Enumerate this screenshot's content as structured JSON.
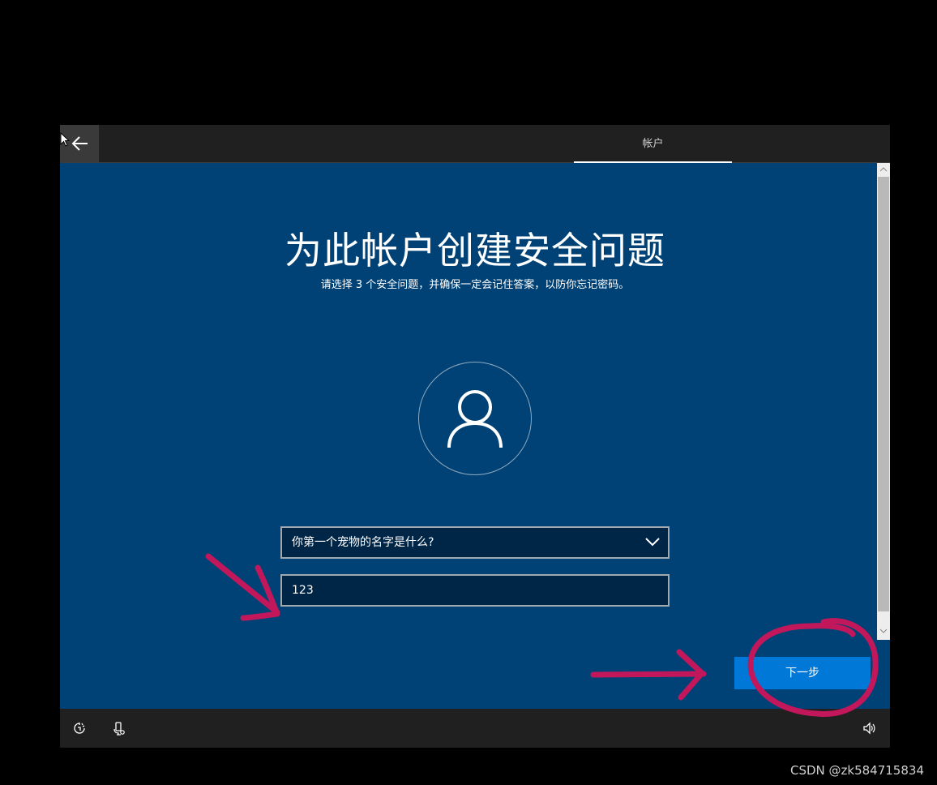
{
  "topbar": {
    "tab_label": "帐户"
  },
  "main": {
    "title": "为此帐户创建安全问题",
    "subtitle": "请选择 3 个安全问题，并确保一定会记住答案，以防你忘记密码。",
    "question_select": {
      "selected": "你第一个宠物的名字是什么?"
    },
    "answer_field": {
      "value": "123"
    },
    "next_button_label": "下一步"
  },
  "watermark": "CSDN @zk584715834",
  "colors": {
    "background": "#004275",
    "accent_button": "#0078d7",
    "annotation": "#c2185b"
  },
  "icons": {
    "back": "back-arrow-icon",
    "avatar": "user-avatar-icon",
    "dropdown": "chevron-down-icon",
    "ease_of_access": "ease-of-access-icon",
    "microphone": "microphone-icon",
    "volume": "volume-icon"
  }
}
